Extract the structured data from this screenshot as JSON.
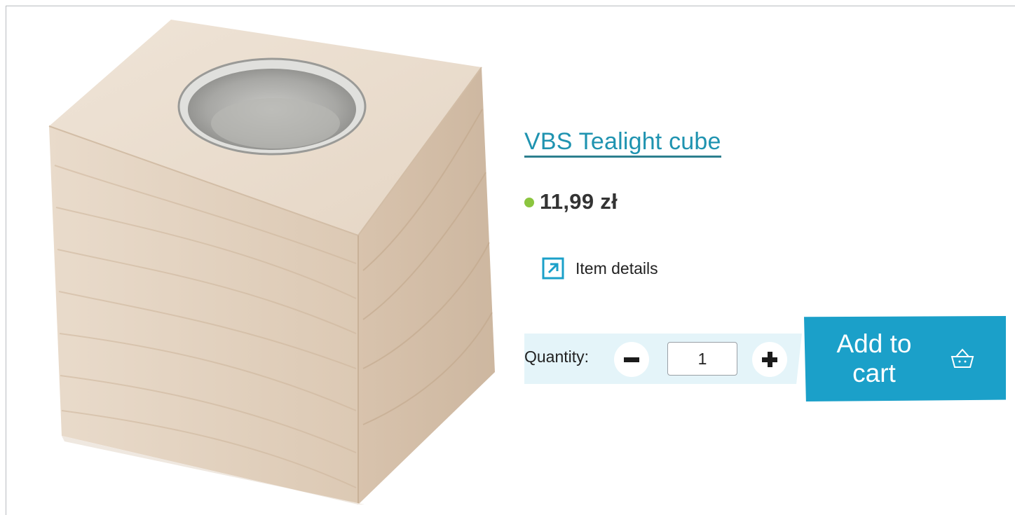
{
  "product": {
    "title": "VBS Tealight cube",
    "price": "11,99 zł",
    "availability_color": "#8bc53f",
    "details_label": "Item details",
    "details_icon": "external-link-arrow-icon"
  },
  "quantity": {
    "label": "Quantity:",
    "value": "1",
    "minus_icon": "minus-icon",
    "plus_icon": "plus-icon"
  },
  "cart": {
    "add_label_line1": "Add to",
    "add_label_line2": "cart",
    "icon": "basket-icon",
    "color": "#1ba0c9"
  },
  "colors": {
    "title": "#1f93b0",
    "quantity_band": "#e4f4f9"
  }
}
